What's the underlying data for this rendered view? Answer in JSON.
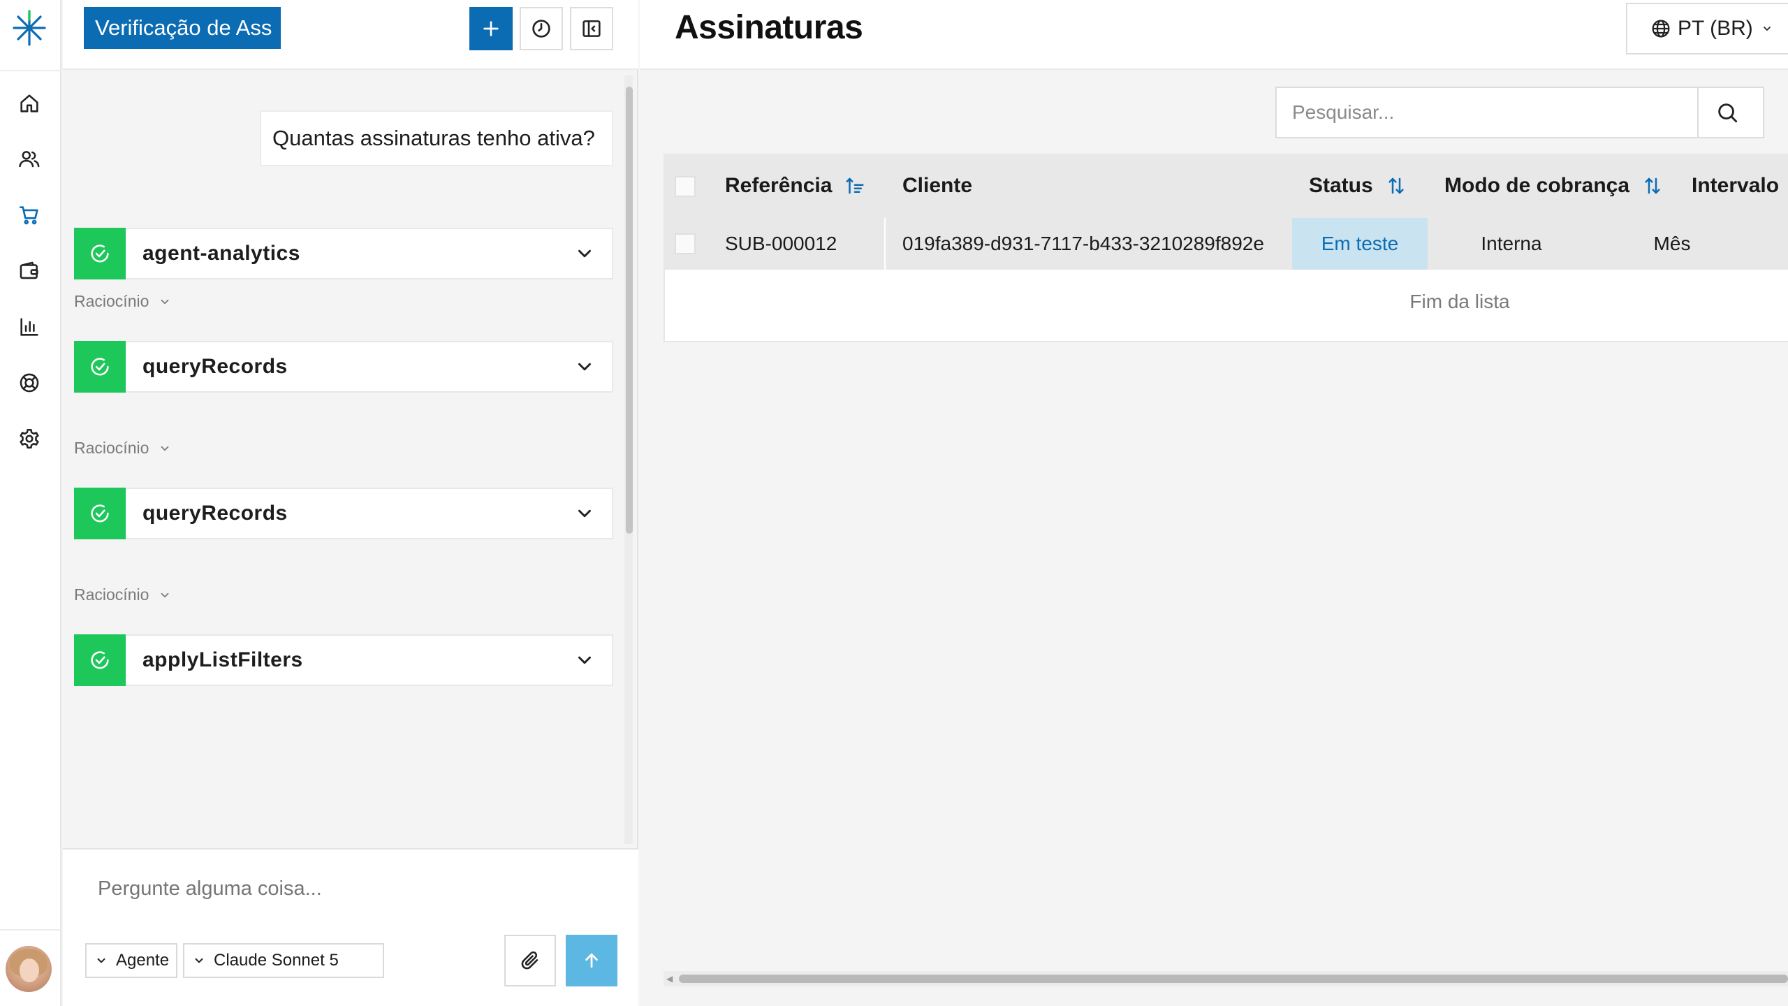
{
  "colors": {
    "accent": "#0b6cb3",
    "success": "#1ec75a",
    "send": "#5cb8e3",
    "status_bg": "#c9e3f1"
  },
  "rail": {
    "icons": [
      "home-icon",
      "users-icon",
      "cart-icon",
      "wallet-icon",
      "bar-chart-icon",
      "lifebuoy-icon",
      "gear-icon"
    ]
  },
  "chat": {
    "title": "Verificação de Ass",
    "user_message": "Quantas assinaturas tenho ativa?",
    "tools": [
      {
        "name": "agent-analytics"
      },
      {
        "name": "queryRecords"
      },
      {
        "name": "queryRecords"
      },
      {
        "name": "applyListFilters"
      }
    ],
    "reasoning_label": "Raciocínio",
    "composer": {
      "placeholder": "Pergunte alguma coisa...",
      "mode": "Agente",
      "model": "Claude Sonnet 5"
    }
  },
  "main": {
    "title": "Assinaturas",
    "language": "PT (BR)",
    "search_placeholder": "Pesquisar...",
    "columns": {
      "reference": "Referência",
      "customer": "Cliente",
      "status": "Status",
      "billing_mode": "Modo de cobrança",
      "interval": "Intervalo"
    },
    "rows": [
      {
        "reference": "SUB-000012",
        "customer": "019fa389-d931-7117-b433-3210289f892e",
        "status": "Em teste",
        "billing_mode": "Interna",
        "interval": "Mês"
      }
    ],
    "end_of_list": "Fim da lista"
  }
}
